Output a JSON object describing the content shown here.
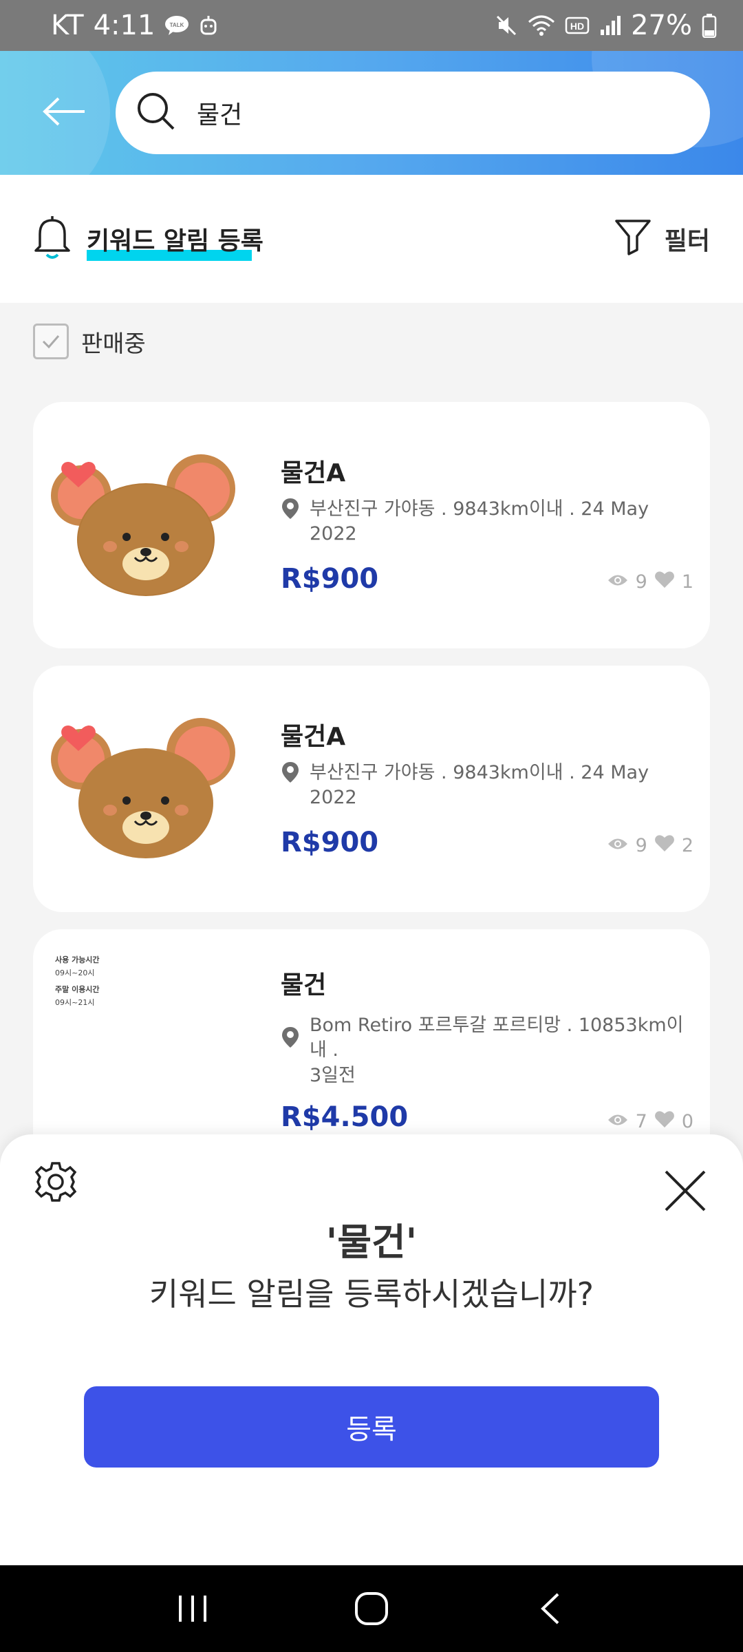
{
  "status_bar": {
    "carrier": "KT",
    "time": "4:11",
    "battery": "27%",
    "left_icons": [
      "kakaotalk-icon",
      "assistant-icon"
    ],
    "right_icons": [
      "mute-icon",
      "wifi-icon",
      "hd-icon",
      "signal-icon",
      "battery-icon"
    ]
  },
  "search": {
    "query": "물건"
  },
  "keyword_alert": {
    "label": "키워드 알림 등록",
    "accent_color": "#00d4ee"
  },
  "filter": {
    "label": "필터"
  },
  "on_sale": {
    "label": "판매중",
    "checked": true
  },
  "listings": [
    {
      "title": "물건A",
      "location": "부산진구 가야동 . 9843km이내 . 24 May 2022",
      "price": "R$900",
      "views": "9",
      "likes": "1",
      "thumbnail": "bear-image"
    },
    {
      "title": "물건A",
      "location": "부산진구 가야동 . 9843km이내 . 24 May 2022",
      "price": "R$900",
      "views": "9",
      "likes": "2",
      "thumbnail": "bear-image"
    },
    {
      "title": "물건",
      "location_line1": "Bom Retiro 포르투갈 포르티망 . 10853km이내 .",
      "location_line2": "3일전",
      "price": "R$4.500",
      "views": "7",
      "likes": "0",
      "thumbnail": "notice-image",
      "thumbnail_text": [
        "사용 가능시간",
        "09시~20시",
        "주말 이용시간",
        "09시~21시"
      ]
    }
  ],
  "sheet": {
    "keyword": "'물건'",
    "question": "키워드 알림을 등록하시겠습니까?",
    "register_label": "등록"
  },
  "colors": {
    "price": "#1f3aa8",
    "primary_button": "#3d52e8",
    "header_gradient_start": "#5fc8ea",
    "header_gradient_end": "#3b88ea"
  }
}
